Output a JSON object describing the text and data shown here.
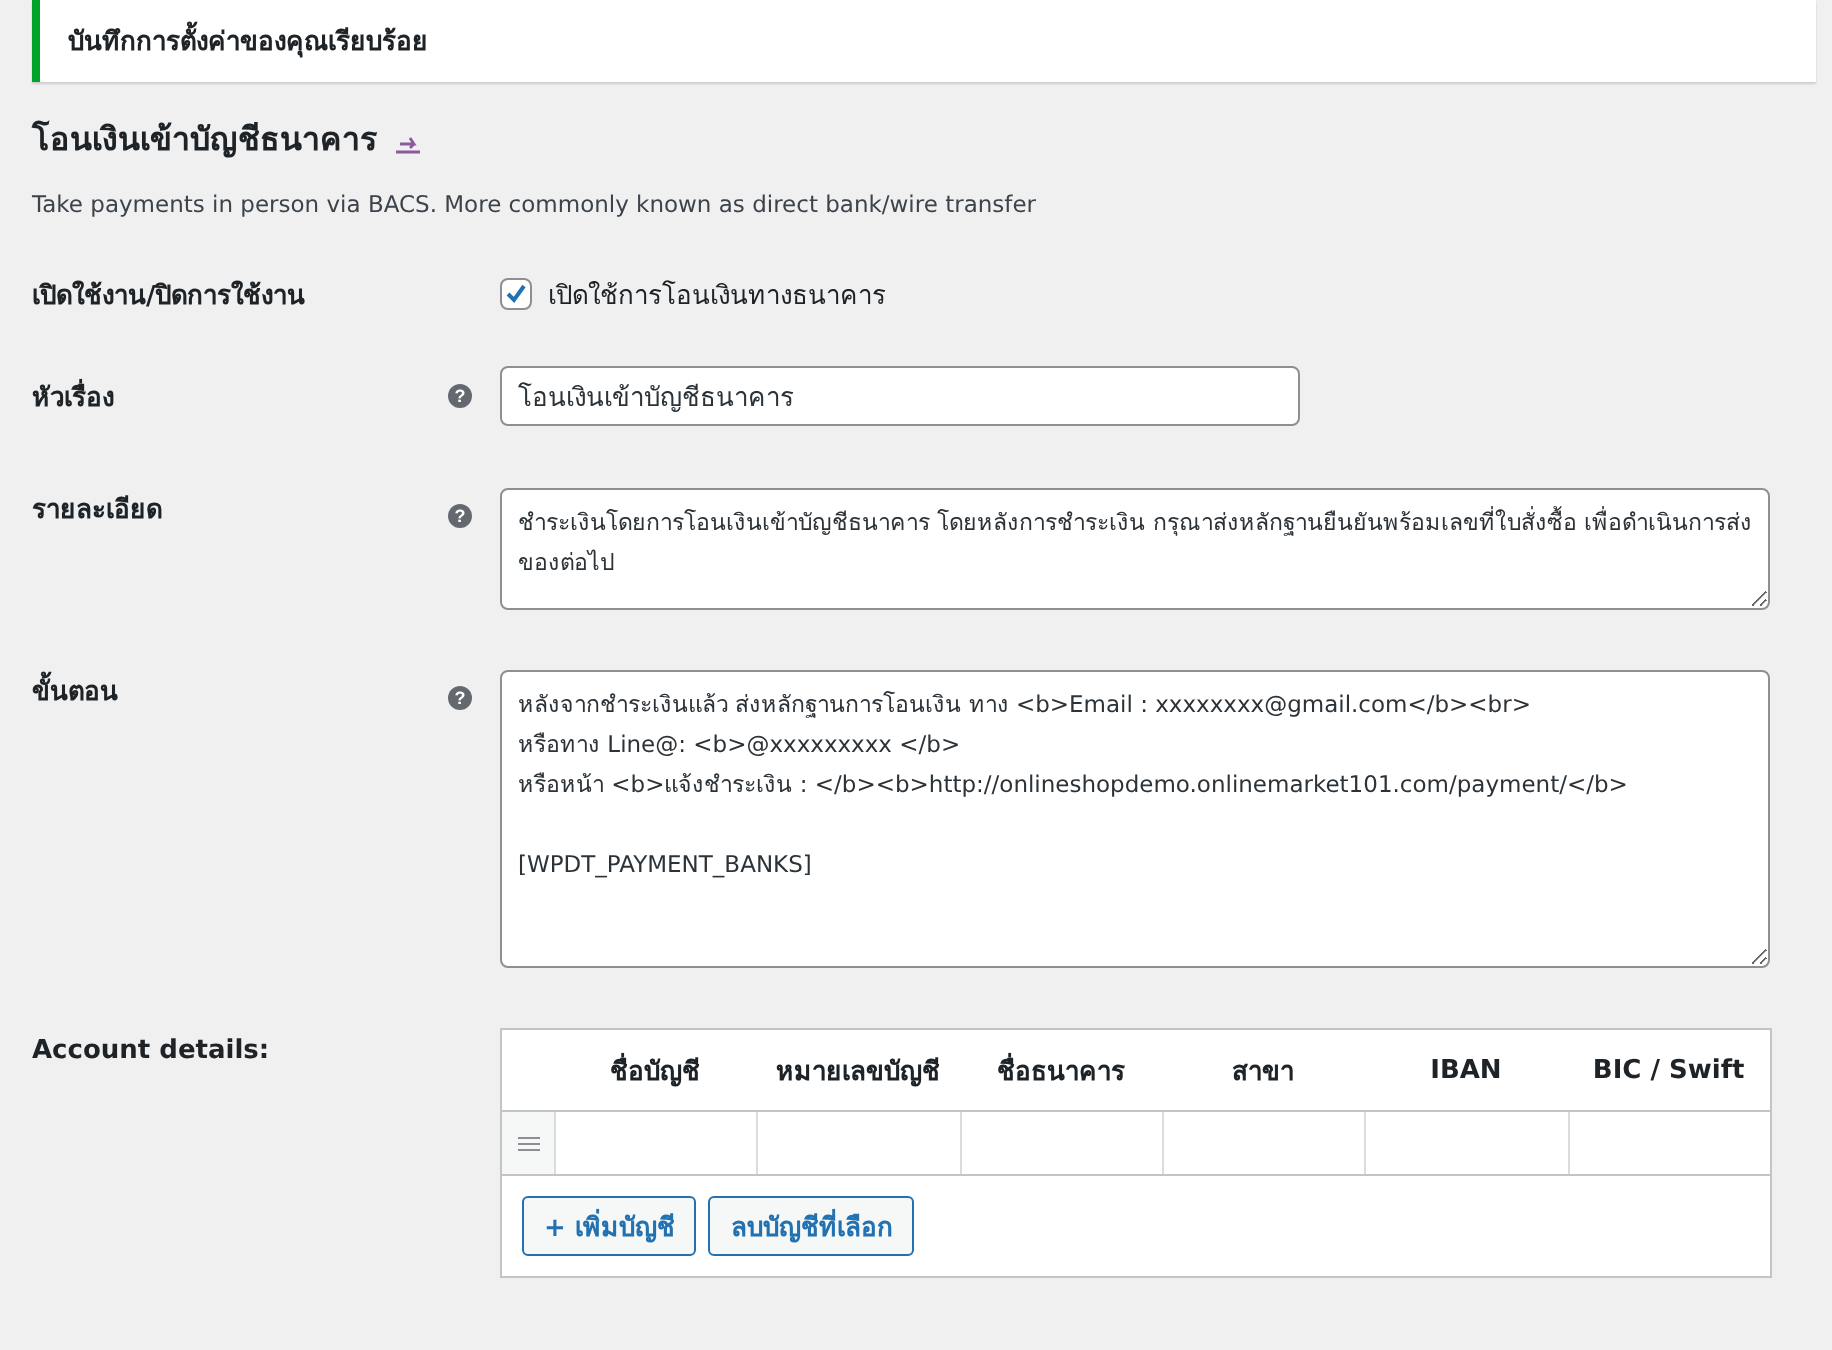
{
  "notice": {
    "text": "บันทึกการตั้งค่าของคุณเรียบร้อย"
  },
  "heading": {
    "title": "โอนเงินเข้าบัญชีธนาคาร"
  },
  "description": "Take payments in person via BACS. More commonly known as direct bank/wire transfer",
  "fields": [
    {
      "kind": "checkbox",
      "label": "เปิดใช้งาน/ปิดการใช้งาน",
      "checked": true,
      "text": "เปิดใช้การโอนเงินทางธนาคาร"
    },
    {
      "kind": "input",
      "label": "หัวเรื่อง",
      "help": "?",
      "value": "โอนเงินเข้าบัญชีธนาคาร"
    },
    {
      "kind": "textarea",
      "label": "รายละเอียด",
      "help": "?",
      "value": "ชำระเงินโดยการโอนเงินเข้าบัญชีธนาคาร โดยหลังการชำระเงิน กรุณาส่งหลักฐานยืนยันพร้อมเลขที่ใบสั่งซื้อ เพื่อดำเนินการส่งของต่อไป"
    },
    {
      "kind": "textarea",
      "label": "ขั้นตอน",
      "help": "?",
      "value": "หลังจากชำระเงินแล้ว ส่งหลักฐานการโอนเงิน ทาง <b>Email : xxxxxxxx@gmail.com</b><br>\nหรือทาง Line@: <b>@xxxxxxxxx </b>\nหรือหน้า <b>แจ้งชำระเงิน : </b><b>http://onlineshopdemo.onlinemarket101.com/payment/</b>\n\n[WPDT_PAYMENT_BANKS]"
    }
  ],
  "accounts": {
    "label": "Account details:",
    "columns": [
      "ชื่อบัญชี",
      "หมายเลขบัญชี",
      "ชื่อธนาคาร",
      "สาขา",
      "IBAN",
      "BIC / Swift"
    ],
    "buttons": [
      "+ เพิ่มบัญชี",
      "ลบบัญชีที่เลือก"
    ]
  }
}
